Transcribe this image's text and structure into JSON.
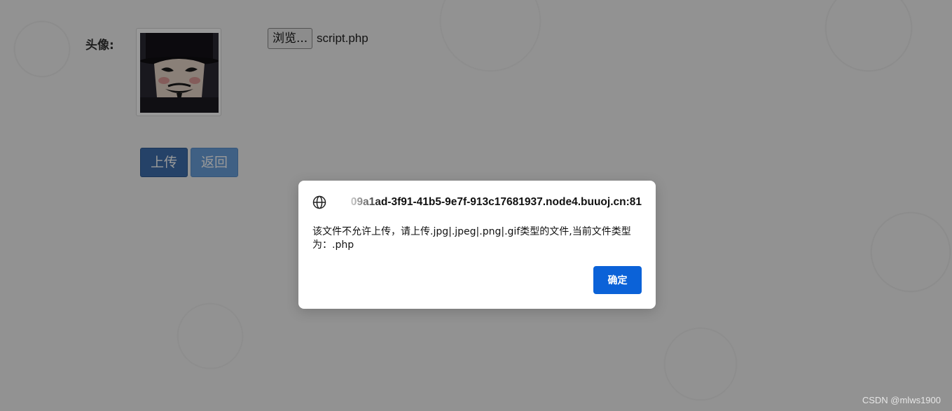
{
  "form": {
    "avatar_label": "头像:",
    "browse_button": "浏览...",
    "file_name": "script.php",
    "upload_button": "上传",
    "back_button": "返回"
  },
  "dialog": {
    "origin": "09a1ad-3f91-41b5-9e7f-913c17681937.node4.buuoj.cn:81",
    "message": "该文件不允许上传，请上传.jpg|.jpeg|.png|.gif类型的文件,当前文件类型为：.php",
    "confirm_button": "确定",
    "icon": "globe-icon"
  },
  "watermark": "CSDN @mlws1900",
  "colors": {
    "confirm_accent": "#0b62d8",
    "upload_button": "#3e6fae",
    "back_button": "#6aa0dd"
  }
}
